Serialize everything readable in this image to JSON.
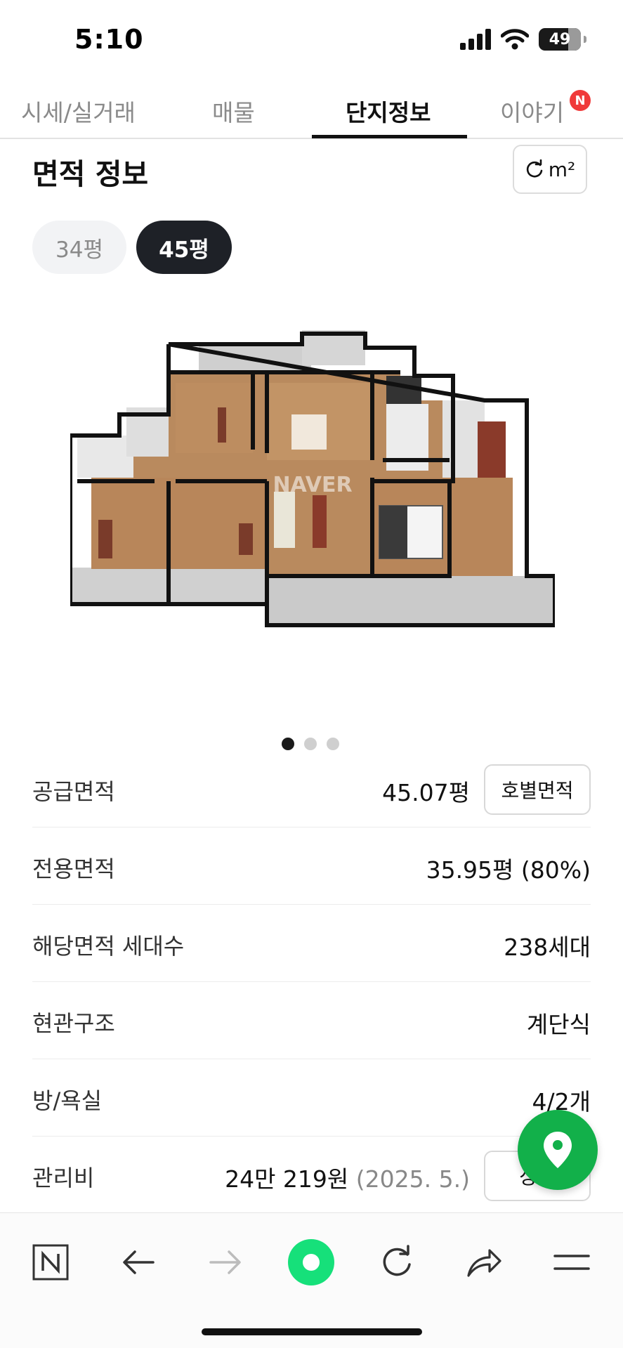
{
  "status": {
    "time": "5:10",
    "battery": "49"
  },
  "tabs": [
    {
      "label": "시세/실거래"
    },
    {
      "label": "매물"
    },
    {
      "label": "단지정보"
    },
    {
      "label": "이야기"
    }
  ],
  "new_badge": "N",
  "section": {
    "title": "면적 정보",
    "unit_label": "m²"
  },
  "chips": [
    {
      "label": "34평"
    },
    {
      "label": "45평"
    }
  ],
  "floorplan": {
    "watermark": "NAVER"
  },
  "carousel": {
    "total": 3,
    "active": 1
  },
  "info": [
    {
      "label": "공급면적",
      "value": "45.07평",
      "button": "호별면적"
    },
    {
      "label": "전용면적",
      "value": "35.95평 (80%)"
    },
    {
      "label": "해당면적 세대수",
      "value": "238세대"
    },
    {
      "label": "현관구조",
      "value": "계단식"
    },
    {
      "label": "방/욕실",
      "value": "4/2개"
    },
    {
      "label": "관리비",
      "value": "24만 219원",
      "value_note": "(2025. 5.)",
      "button": "상세"
    }
  ],
  "colors": {
    "accent_green": "#12b04a",
    "badge_red": "#f03a3a",
    "active_chip": "#1e2127"
  },
  "icons": {
    "map_fab": "map-pin-icon",
    "toolbar": [
      "naver-n-icon",
      "back-arrow-icon",
      "forward-arrow-icon",
      "green-dot-icon",
      "reload-icon",
      "share-icon",
      "menu-icon"
    ]
  }
}
